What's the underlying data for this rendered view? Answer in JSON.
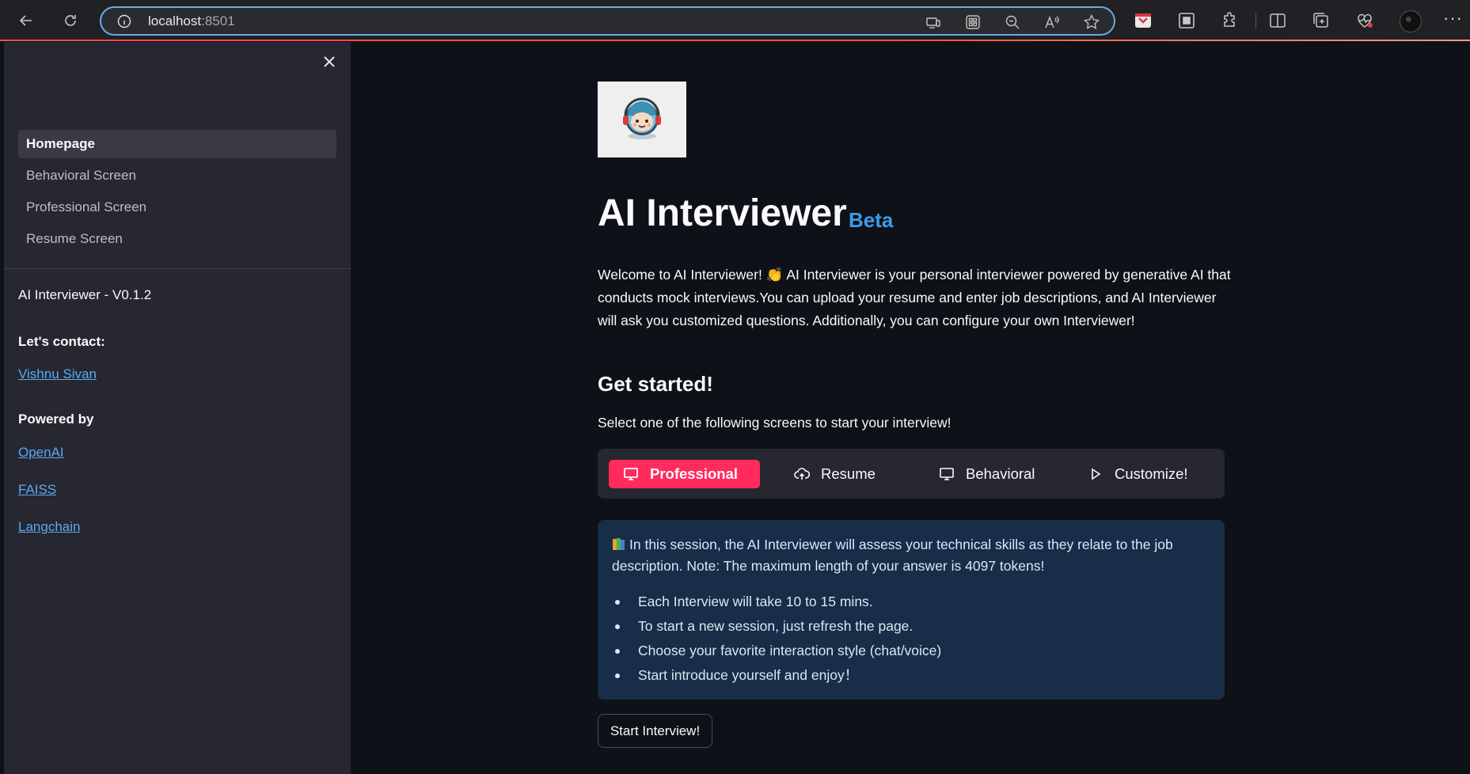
{
  "browser": {
    "url_host": "localhost",
    "url_port": ":8501"
  },
  "sidebar": {
    "nav_items": [
      {
        "label": "Homepage",
        "active": true
      },
      {
        "label": "Behavioral Screen",
        "active": false
      },
      {
        "label": "Professional Screen",
        "active": false
      },
      {
        "label": "Resume Screen",
        "active": false
      }
    ],
    "version": "AI Interviewer - V0.1.2",
    "contact_heading": "Let's contact:",
    "contact_link": "Vishnu Sivan",
    "powered_heading": "Powered by",
    "powered_links": [
      "OpenAI",
      "FAISS",
      "Langchain"
    ]
  },
  "main": {
    "title": "AI Interviewer",
    "badge": "Beta",
    "intro": "Welcome to AI Interviewer! 👏 AI Interviewer is your personal interviewer powered by generative AI that conducts mock interviews.You can upload your resume and enter job descriptions, and AI Interviewer will ask you customized questions. Additionally, you can configure your own Interviewer!",
    "get_started_heading": "Get started!",
    "select_text": "Select one of the following screens to start your interview!",
    "tabs": [
      {
        "label": "Professional",
        "icon": "monitor-icon",
        "active": true
      },
      {
        "label": "Resume",
        "icon": "cloud-upload-icon",
        "active": false
      },
      {
        "label": "Behavioral",
        "icon": "monitor-icon",
        "active": false
      },
      {
        "label": "Customize!",
        "icon": "play-icon",
        "active": false
      }
    ],
    "info": {
      "paragraph": "In this session, the AI Interviewer will assess your technical skills as they relate to the job description. Note: The maximum length of your answer is 4097 tokens!",
      "bullets": [
        "Each Interview will take 10 to 15 mins.",
        "To start a new session, just refresh the page.",
        "Choose your favorite interaction style (chat/voice)",
        "Start introduce yourself and enjoy！"
      ]
    },
    "start_button": "Start Interview!"
  },
  "colors": {
    "accent_primary": "#ff2b5c",
    "link": "#5aa9f5",
    "beta": "#3d9be9",
    "info_bg": "#172d48",
    "sidebar_bg": "#262730",
    "main_bg": "#0e1117"
  }
}
